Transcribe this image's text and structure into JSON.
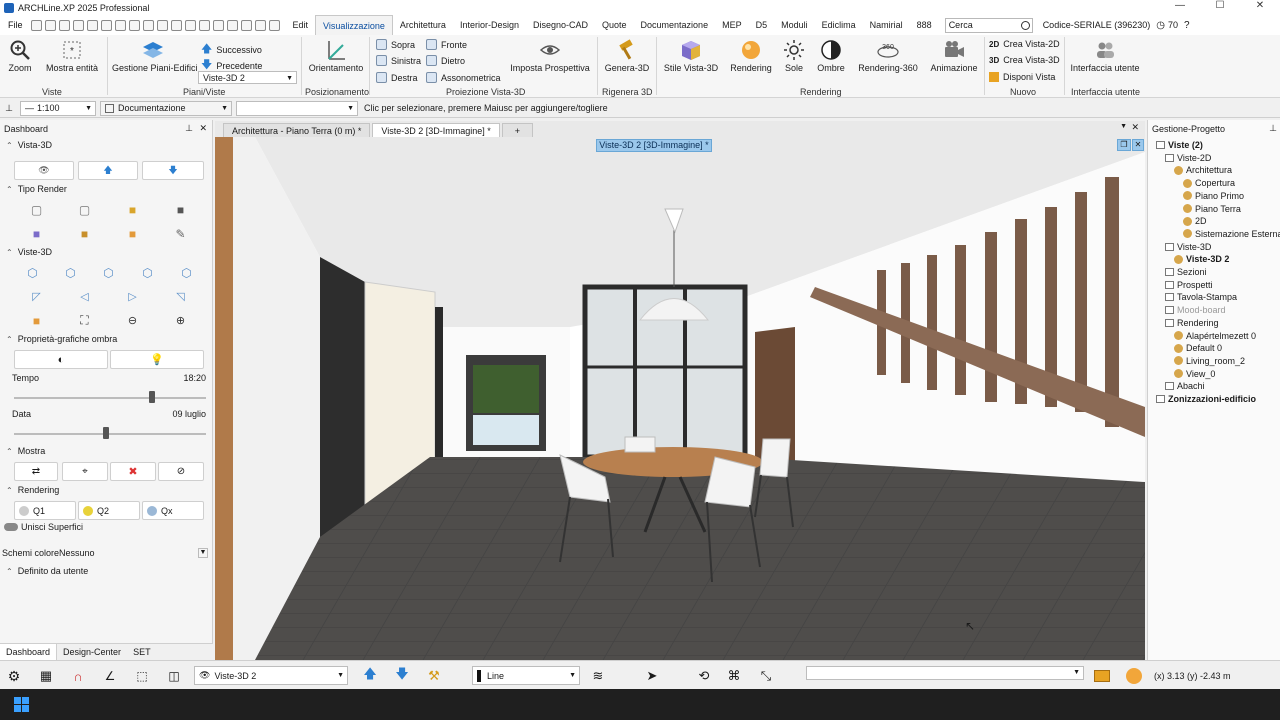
{
  "window": {
    "title": "ARCHLine.XP 2025 Professional",
    "controls": [
      "—",
      "☐",
      "✕"
    ]
  },
  "menu": {
    "file": "File",
    "tabs": [
      "Edit",
      "Visualizzazione",
      "Architettura",
      "Interior-Design",
      "Disegno-CAD",
      "Quote",
      "Documentazione",
      "MEP",
      "D5",
      "Moduli",
      "Ediclima",
      "Namirial",
      "888"
    ],
    "active_tab": "Visualizzazione",
    "search_placeholder": "Cerca",
    "serial": "Codice-SERIALE (396230)",
    "counter": "70"
  },
  "ribbon": {
    "zoom": "Zoom",
    "mostra_entita": "Mostra entità",
    "gestione_piani": "Gestione Piani-Edifici",
    "successivo": "Successivo",
    "precedente": "Precedente",
    "view_select": "Viste-3D 2",
    "orientamento": "Orientamento",
    "sopra": "Sopra",
    "fronte": "Fronte",
    "sinistra": "Sinistra",
    "dietro": "Dietro",
    "destra": "Destra",
    "assonometrica": "Assonometrica",
    "imposta_prospettiva": "Imposta Prospettiva",
    "genera_3d": "Genera-3D",
    "stile_vista": "Stile Vista-3D",
    "rendering": "Rendering",
    "sole": "Sole",
    "ombre": "Ombre",
    "rendering_360": "Rendering-360",
    "animazione": "Animazione",
    "crea_vista_2d": "Crea Vista-2D",
    "crea_vista_3d": "Crea Vista-3D",
    "disponi_vista": "Disponi Vista",
    "interfaccia": "Interfaccia utente",
    "groups": {
      "viste": "Viste",
      "piani_viste": "Piani/Viste",
      "posizionamento": "Posizionamento",
      "proiezione": "Proiezione Vista-3D",
      "rigenera": "Rigenera 3D",
      "rendering": "Rendering",
      "nuovo": "Nuovo",
      "interfaccia": "Interfaccia utente"
    }
  },
  "toolbar2": {
    "scale": "1:100",
    "layer": "Documentazione",
    "status": "Clic per selezionare, premere Maiusc per aggiungere/togliere"
  },
  "dashboard": {
    "title": "Dashboard",
    "sections": {
      "vista3d": "Vista-3D",
      "tipo_render": "Tipo Render",
      "viste3d": "Viste-3D",
      "proprieta_ombra": "Proprietà-grafiche ombra",
      "mostra": "Mostra",
      "rendering": "Rendering",
      "definito": "Definito da utente"
    },
    "tempo_label": "Tempo",
    "tempo_value": "18:20",
    "tempo_pos": 0.72,
    "data_label": "Data",
    "data_value": "09 luglio",
    "data_pos": 0.48,
    "q1": "Q1",
    "q2": "Q2",
    "qx": "Qx",
    "unisci": "Unisci Superfici",
    "schemi_label": "Schemi colore",
    "schemi_value": "Nessuno",
    "bottom_tabs": [
      "Dashboard",
      "Design-Center",
      "SET"
    ]
  },
  "viewport": {
    "tabs": [
      "Architettura - Piano Terra (0 m) *",
      "Viste-3D 2 [3D-Immagine] *",
      "+"
    ],
    "active_label": "Viste-3D 2 [3D-Immagine] *"
  },
  "project": {
    "title": "Gestione-Progetto",
    "tree": [
      {
        "label": "Viste (2)",
        "level": 0
      },
      {
        "label": "Viste-2D",
        "level": 1
      },
      {
        "label": "Architettura",
        "level": 2
      },
      {
        "label": "Copertura",
        "level": 3
      },
      {
        "label": "Piano Primo",
        "level": 3
      },
      {
        "label": "Piano Terra",
        "level": 3
      },
      {
        "label": "2D",
        "level": 3
      },
      {
        "label": "Sistemazione Esterna",
        "level": 3
      },
      {
        "label": "Viste-3D",
        "level": 1
      },
      {
        "label": "Viste-3D 2",
        "level": 2
      },
      {
        "label": "Sezioni",
        "level": 1
      },
      {
        "label": "Prospetti",
        "level": 1
      },
      {
        "label": "Tavola-Stampa",
        "level": 1
      },
      {
        "label": "Mood-board",
        "level": 1
      },
      {
        "label": "Rendering",
        "level": 1
      },
      {
        "label": "Alapértelmezett 0",
        "level": 2
      },
      {
        "label": "Default 0",
        "level": 2
      },
      {
        "label": "Living_room_2",
        "level": 2
      },
      {
        "label": "View_0",
        "level": 2
      },
      {
        "label": "Abachi",
        "level": 1
      },
      {
        "label": "Zonizzazioni-edificio",
        "level": 0
      }
    ]
  },
  "bottombar": {
    "view_select": "Viste-3D 2",
    "line_select": "Line",
    "coords": "(x) 3.13   (y) -2.43 m"
  }
}
